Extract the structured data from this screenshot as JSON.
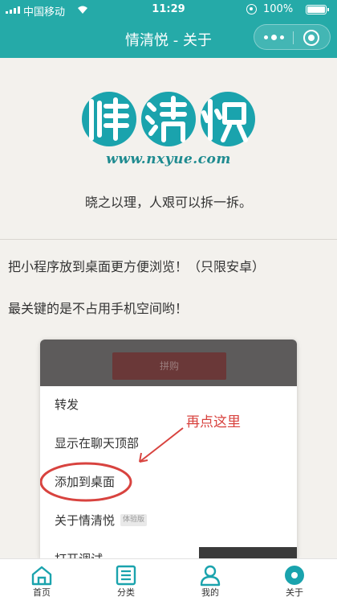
{
  "status_bar": {
    "carrier": "中国移动",
    "time": "11:29",
    "battery": "100%"
  },
  "nav": {
    "title": "情清悦 - 关于"
  },
  "logo": {
    "url": "www.nxyue.com"
  },
  "content": {
    "slogan": "晓之以理，人艰可以拆一拆。",
    "para1": "把小程序放到桌面更方便浏览！（只限安卓）",
    "para2": "最关键的是不占用手机空间哟！"
  },
  "screenshot": {
    "header_button": "拼购",
    "menu": [
      "转发",
      "显示在聊天顶部",
      "添加到桌面",
      "关于情清悦",
      "打开调试"
    ],
    "tag": "体验版",
    "annotation": "再点这里"
  },
  "tabbar": {
    "items": [
      {
        "label": "首页",
        "icon": "home-icon"
      },
      {
        "label": "分类",
        "icon": "list-icon"
      },
      {
        "label": "我的",
        "icon": "user-icon"
      },
      {
        "label": "关于",
        "icon": "about-icon"
      }
    ],
    "active_index": 3
  },
  "colors": {
    "accent": "#25aaa8",
    "annotation": "#d8433f"
  }
}
